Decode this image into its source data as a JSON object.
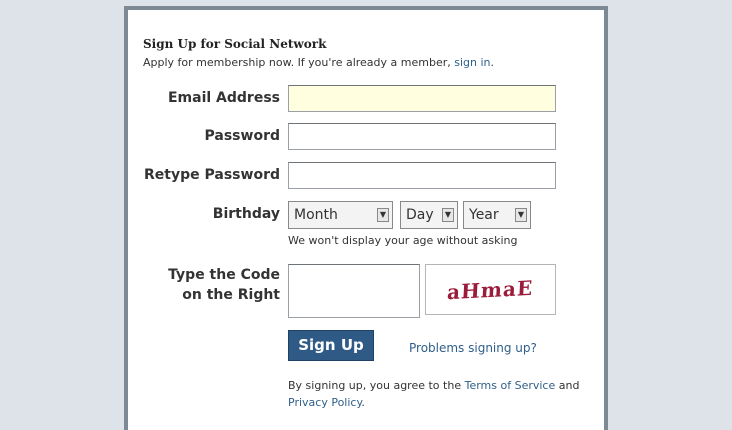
{
  "header": {
    "title": "Sign Up for Social Network",
    "subtitle_text": "Apply for membership now. If you're already a member,",
    "signin_link": "sign in",
    "subtitle_end": "."
  },
  "fields": {
    "email_label": "Email Address",
    "email_value": "",
    "password_label": "Password",
    "password_value": "",
    "retype_label": "Retype Password",
    "retype_value": "",
    "birthday_label": "Birthday",
    "month": "Month",
    "day": "Day",
    "year": "Year",
    "birthday_hint": "We won't display your age without asking",
    "code_label_line1": "Type the Code",
    "code_label_line2": "on the Right",
    "code_value": "",
    "captcha_text": "aHmaE"
  },
  "actions": {
    "signup_label": "Sign Up",
    "problems_link": "Problems signing up?"
  },
  "terms": {
    "prefix": "By signing up, you agree to the",
    "tos_link": "Terms of Service",
    "and": "and",
    "privacy_link": "Privacy Policy",
    "suffix": "."
  },
  "colors": {
    "background": "#dde3e9",
    "card_border": "#7d8a96",
    "link": "#2e5f8a",
    "button": "#2f5a86",
    "captcha": "#9b1b3a",
    "focused_input": "#ffffe0"
  }
}
